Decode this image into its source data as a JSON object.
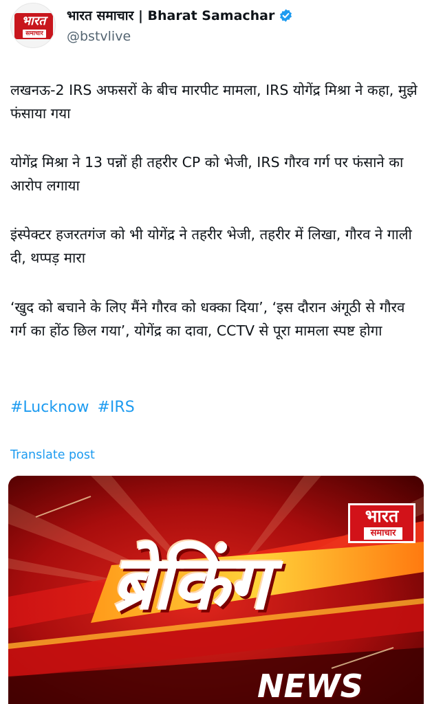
{
  "author": {
    "display_name": "भारत समाचार | Bharat Samachar",
    "handle": "@bstvlive",
    "avatar_logo_top": "भारत",
    "avatar_logo_bottom": "समाचार",
    "verified_icon": "verified-badge-icon"
  },
  "post": {
    "paragraphs": [
      "लखनऊ-2 IRS अफसरों के बीच मारपीट मामला, IRS योगेंद्र मिश्रा ने कहा, मुझे फंसाया गया",
      "योगेंद्र मिश्रा ने 13 पन्नों ही तहरीर CP को भेजी, IRS गौरव गर्ग पर फंसाने का आरोप लगाया",
      "इंस्पेक्टर हजरतगंज को भी योगेंद्र ने तहरीर भेजी, तहरीर में लिखा, गौरव ने गाली दी, थप्पड़ मारा",
      "‘खुद को बचाने के लिए मैंने गौरव को धक्का दिया’, ‘इस दौरान अंगूठी से गौरव गर्ग का होंठ छिल गया’, योगेंद्र का दावा, CCTV से पूरा मामला स्पष्ट होगा"
    ],
    "hashtags": [
      "#Lucknow",
      "#IRS"
    ],
    "translate_label": "Translate post"
  },
  "media": {
    "badge_top": "भारत",
    "badge_bottom": "समाचार",
    "headline": "ब्रेकिंग",
    "news_label": "NEWS"
  },
  "colors": {
    "link": "#1d9bf0",
    "brand_red": "#d21219",
    "verified": "#1d9bf0"
  }
}
